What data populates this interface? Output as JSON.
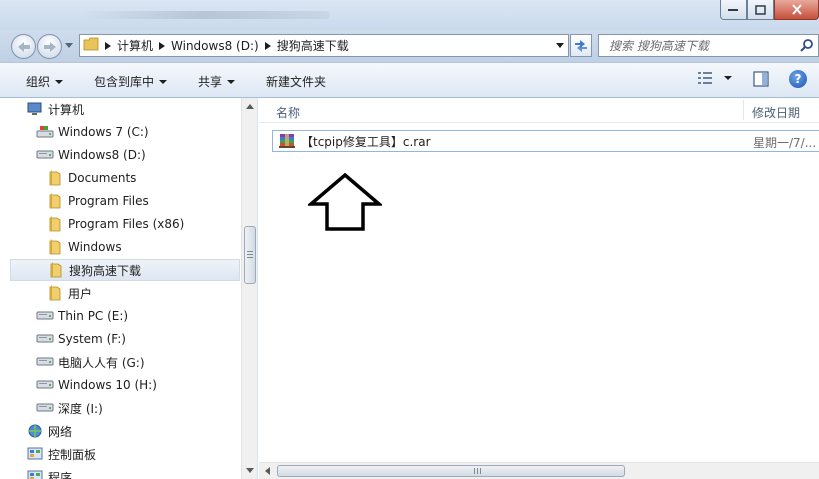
{
  "window": {
    "controls": [
      "minimize",
      "maximize",
      "close"
    ]
  },
  "address": {
    "crumbs": [
      "计算机",
      "Windows8 (D:)",
      "搜狗高速下载"
    ]
  },
  "search": {
    "placeholder": "搜索 搜狗高速下载"
  },
  "toolbar": {
    "organize": "组织",
    "include_in_library": "包含到库中",
    "share": "共享",
    "new_folder": "新建文件夹"
  },
  "nav": {
    "items": [
      {
        "label": "计算机",
        "icon": "computer-icon"
      },
      {
        "label": "Windows 7  (C:)",
        "icon": "system-drive-icon"
      },
      {
        "label": "Windows8 (D:)",
        "icon": "drive-icon"
      },
      {
        "label": "Documents",
        "icon": "folder-icon"
      },
      {
        "label": "Program Files",
        "icon": "folder-icon"
      },
      {
        "label": "Program Files (x86)",
        "icon": "folder-icon"
      },
      {
        "label": "Windows",
        "icon": "folder-icon"
      },
      {
        "label": "搜狗高速下载",
        "icon": "folder-icon",
        "selected": true
      },
      {
        "label": "用户",
        "icon": "folder-icon"
      },
      {
        "label": "Thin PC (E:)",
        "icon": "drive-icon"
      },
      {
        "label": "System (F:)",
        "icon": "drive-icon"
      },
      {
        "label": "电脑人人有 (G:)",
        "icon": "drive-icon"
      },
      {
        "label": "Windows 10 (H:)",
        "icon": "drive-icon"
      },
      {
        "label": "深度 (I:)",
        "icon": "drive-icon"
      },
      {
        "label": "网络",
        "icon": "network-icon"
      },
      {
        "label": "控制面板",
        "icon": "control-panel-icon"
      },
      {
        "label": "程序",
        "icon": "control-panel-icon"
      }
    ]
  },
  "content": {
    "columns": {
      "name": "名称",
      "date": "修改日期"
    },
    "files": [
      {
        "name": "【tcpip修复工具】c.rar",
        "date": "星期一/7/...",
        "icon": "rar-archive-icon"
      }
    ]
  },
  "colors": {
    "selection_border": "#8fb8e0",
    "chrome_blue": "#c9d9ec"
  }
}
